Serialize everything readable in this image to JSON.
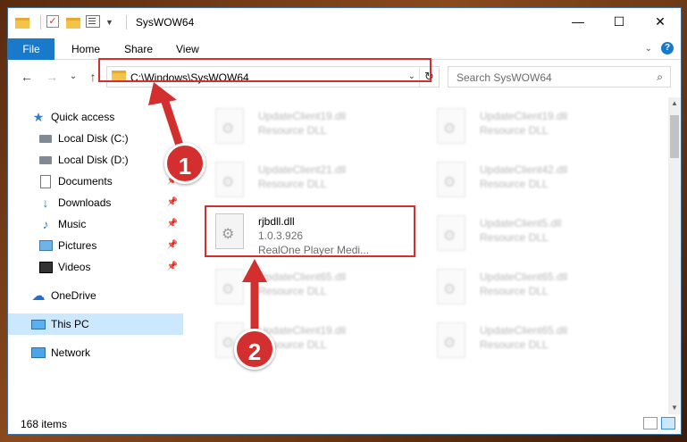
{
  "window": {
    "title": "SysWOW64",
    "controls": {
      "minimize": "—",
      "maximize": "☐",
      "close": "✕"
    }
  },
  "ribbon": {
    "tabs": [
      "File",
      "Home",
      "Share",
      "View"
    ],
    "help": "?"
  },
  "nav": {
    "back": "←",
    "forward": "→",
    "recent": "⌄",
    "up": "↑",
    "address": "C:\\Windows\\SysWOW64",
    "search_placeholder": "Search SysWOW64"
  },
  "sidebar": {
    "items": [
      {
        "label": "Quick access",
        "icon": "star-icon"
      },
      {
        "label": "Local Disk (C:)",
        "icon": "disk-icon"
      },
      {
        "label": "Local Disk (D:)",
        "icon": "disk-icon"
      },
      {
        "label": "Documents",
        "icon": "documents-icon",
        "pinned": true
      },
      {
        "label": "Downloads",
        "icon": "download-icon",
        "pinned": true
      },
      {
        "label": "Music",
        "icon": "music-icon",
        "pinned": true
      },
      {
        "label": "Pictures",
        "icon": "pictures-icon",
        "pinned": true
      },
      {
        "label": "Videos",
        "icon": "videos-icon",
        "pinned": true
      },
      {
        "label": "OneDrive",
        "icon": "onedrive-icon"
      },
      {
        "label": "This PC",
        "icon": "pc-icon",
        "selected": true
      },
      {
        "label": "Network",
        "icon": "network-icon"
      }
    ]
  },
  "files": [
    {
      "name": "UpdateClient19.dll",
      "type": "Resource DLL"
    },
    {
      "name": "UpdateClient19.dll",
      "type": "Resource DLL"
    },
    {
      "name": "UpdateClient21.dll",
      "type": "Resource DLL"
    },
    {
      "name": "UpdateClient42.dll",
      "type": "Resource DLL"
    },
    {
      "name": "rjbdll.dll",
      "version": "1.0.3.926",
      "type": "RealOne Player Medi..."
    },
    {
      "name": "UpdateClient5.dll",
      "type": "Resource DLL"
    },
    {
      "name": "UpdateClient65.dll",
      "type": "Resource DLL"
    },
    {
      "name": "UpdateClient65.dll",
      "type": "Resource DLL"
    },
    {
      "name": "UpdateClient19.dll",
      "type": "Resource DLL"
    },
    {
      "name": "UpdateClient65.dll",
      "type": "Resource DLL"
    }
  ],
  "status": {
    "count": "168 items"
  },
  "annotations": {
    "step1": "1",
    "step2": "2"
  },
  "colors": {
    "accent": "#1979ca",
    "highlight": "#d32f2f",
    "selection": "#cce8ff"
  }
}
